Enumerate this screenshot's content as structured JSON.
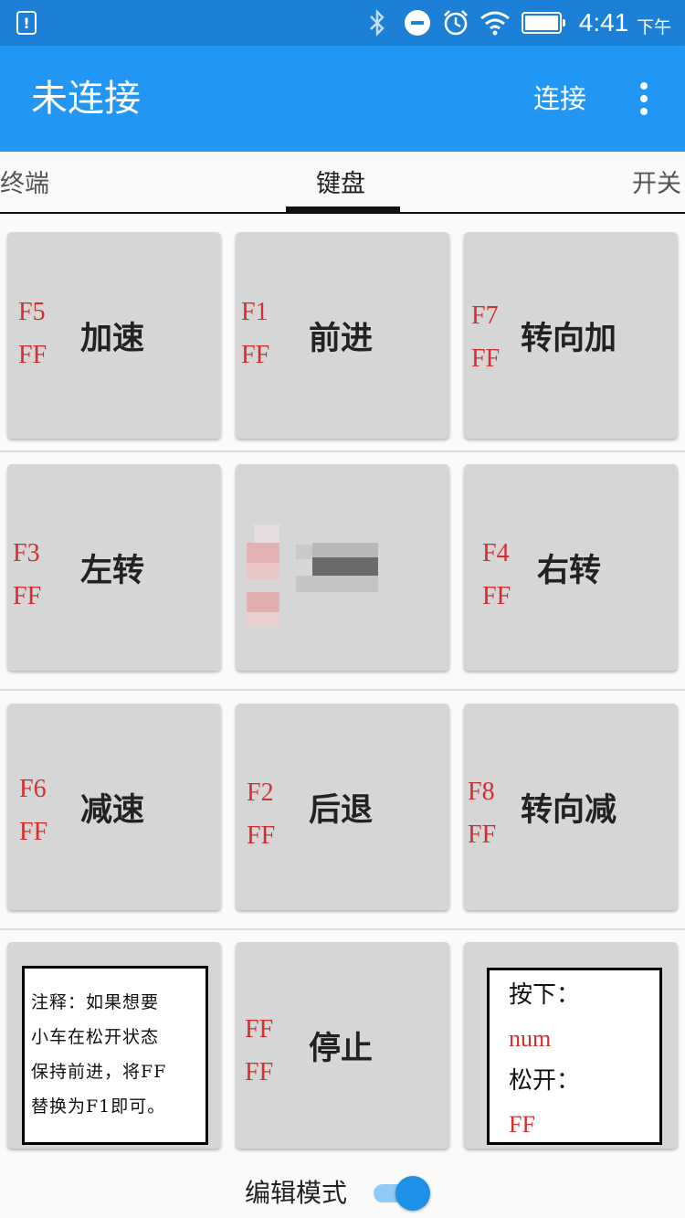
{
  "status_bar": {
    "time": "4:41",
    "ampm": "下午",
    "icons": [
      "alert-icon",
      "bluetooth-icon",
      "do-not-disturb-icon",
      "alarm-icon",
      "wifi-icon",
      "battery-icon"
    ]
  },
  "app_bar": {
    "title": "未连接",
    "connect_label": "连接",
    "menu_icon": "more-vertical-icon",
    "color": "#2196f3",
    "status_color": "#1c81d6"
  },
  "tabs": [
    {
      "label": "终端",
      "active": false
    },
    {
      "label": "键盘",
      "active": true
    },
    {
      "label": "开关",
      "active": false
    }
  ],
  "keys": [
    {
      "press": "F5",
      "release": "FF",
      "label": "加速"
    },
    {
      "press": "F1",
      "release": "FF",
      "label": "前进"
    },
    {
      "press": "F7",
      "release": "FF",
      "label": "转向加"
    },
    {
      "press": "F3",
      "release": "FF",
      "label": "左转"
    },
    {
      "press": "",
      "release": "",
      "label": ""
    },
    {
      "press": "F4",
      "release": "FF",
      "label": "右转"
    },
    {
      "press": "F6",
      "release": "FF",
      "label": "减速"
    },
    {
      "press": "F2",
      "release": "FF",
      "label": "后退"
    },
    {
      "press": "F8",
      "release": "FF",
      "label": "转向减"
    },
    {
      "press": "FF",
      "release": "FF",
      "label": "停止"
    }
  ],
  "note": {
    "lines": [
      "注释：如果想要",
      "小车在松开状态",
      "保持前进，将FF",
      "替换为F1即可。"
    ]
  },
  "legend": {
    "press_label": "按下：",
    "press_value": "num",
    "release_label": "松开：",
    "release_value": "FF"
  },
  "edit_mode": {
    "label": "编辑模式",
    "enabled": true
  },
  "accent_red": "#d32f2f"
}
